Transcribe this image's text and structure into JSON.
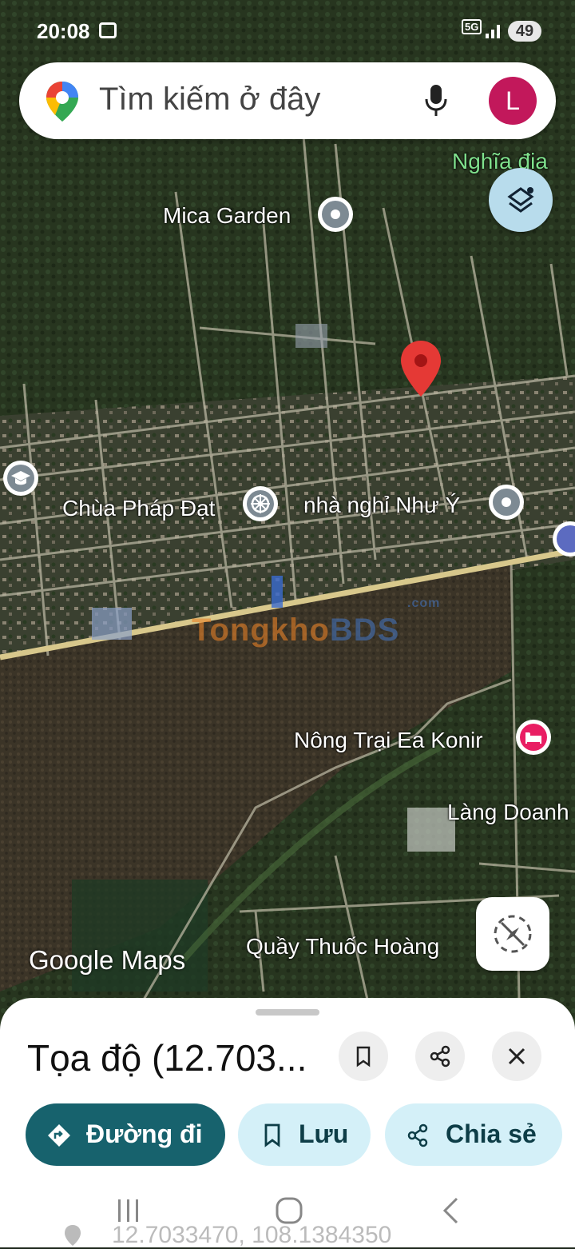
{
  "colors": {
    "accent": "#17626d",
    "chip": "#d4f0f8",
    "sheet": "#ffffff",
    "red_pin": "#e53935",
    "hotel": "#e91e63"
  },
  "status_bar": {
    "time": "20:08",
    "network": "5G",
    "battery": "49"
  },
  "search": {
    "placeholder": "Tìm kiếm ở đây",
    "avatar_letter": "L"
  },
  "map": {
    "labels": {
      "nghia_dia": "Nghĩa địa",
      "mica_garden": "Mica Garden",
      "chua_phap_dat": "Chùa Pháp Đạt",
      "nha_nghi": "nhà nghỉ Như Ý",
      "nong_trai": "Nông Trại Ea Konir",
      "lang_doanh": "Làng Doanh",
      "quay_thuoc": "Quầy Thuốc Hoàng"
    },
    "watermark": {
      "part1": "Tongkho",
      "part2": "BDS",
      "small": ".com"
    },
    "attribution": "Google Maps"
  },
  "sheet": {
    "title": "Tọa độ (12.703...",
    "buttons": {
      "directions": "Đường đi",
      "save": "Lưu",
      "share": "Chia sẻ"
    },
    "coordinates": "12.7033470, 108.1384350"
  },
  "icons": [
    "maps-pin-icon",
    "mic-icon",
    "layers-icon",
    "graduation-icon",
    "dharma-wheel-icon",
    "hotel-icon",
    "compass-icon",
    "bookmark-icon",
    "share-icon",
    "close-icon",
    "directions-icon",
    "recents-icon",
    "home-icon",
    "back-icon",
    "location-icon"
  ]
}
